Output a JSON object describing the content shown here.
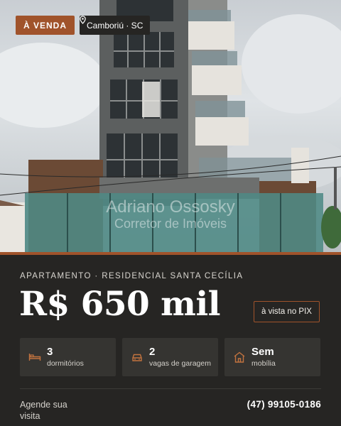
{
  "listing": {
    "status_badge": "À VENDA",
    "location": "Camboriú · SC",
    "watermark_line1": "Adriano Ossosky",
    "watermark_line2": "Corretor de Imóveis",
    "kicker": "APARTAMENTO · RESIDENCIAL SANTA CECÍLIA",
    "price": "R$ 650 mil",
    "payment_note": "à vista no PIX"
  },
  "features": [
    {
      "value": "3",
      "label": "dormitórios",
      "icon": "bed-icon"
    },
    {
      "value": "2",
      "label": "vagas de garagem",
      "icon": "car-icon"
    },
    {
      "value": "Sem",
      "label": "mobília",
      "icon": "house-icon"
    }
  ],
  "contact": {
    "cta": "Agende sua visita",
    "phone": "(47) 99105-0186"
  },
  "colors": {
    "accent": "#a0532b",
    "background": "#262523",
    "card": "#353431"
  }
}
